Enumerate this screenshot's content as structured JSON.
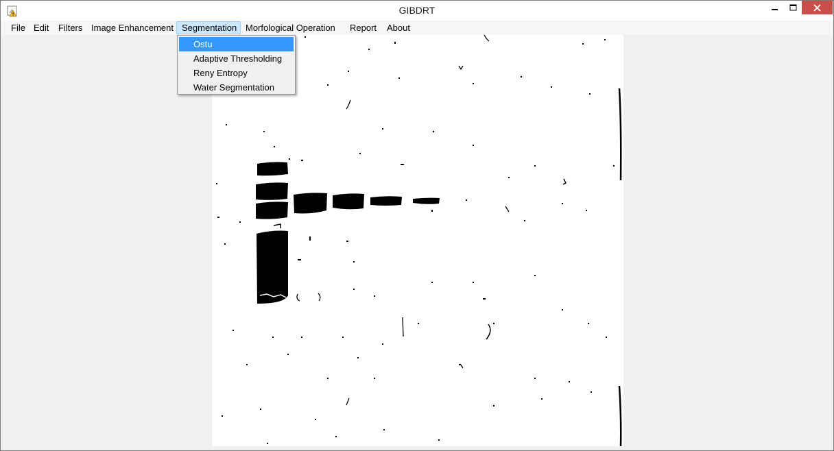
{
  "window": {
    "title": "GIBDRT"
  },
  "menubar": {
    "items": [
      "File",
      "Edit",
      "Filters",
      "Image Enhancement",
      "Segmentation",
      "Morfological Operation",
      "Report",
      "About"
    ],
    "active": "Segmentation"
  },
  "segmentation_menu": {
    "items": [
      "Ostu",
      "Adaptive Thresholding",
      "Reny Entropy",
      "Water Segmentation"
    ],
    "highlighted": "Ostu"
  },
  "icons": {
    "app": "app-icon",
    "minimize": "minimize-icon",
    "maximize": "maximize-icon",
    "close": "close-icon"
  },
  "colors": {
    "menu_highlight": "#3399ff",
    "active_menu_bg": "#cce8ff",
    "close_button": "#c7504b",
    "image_foreground": "#000000",
    "image_background": "#ffffff"
  }
}
